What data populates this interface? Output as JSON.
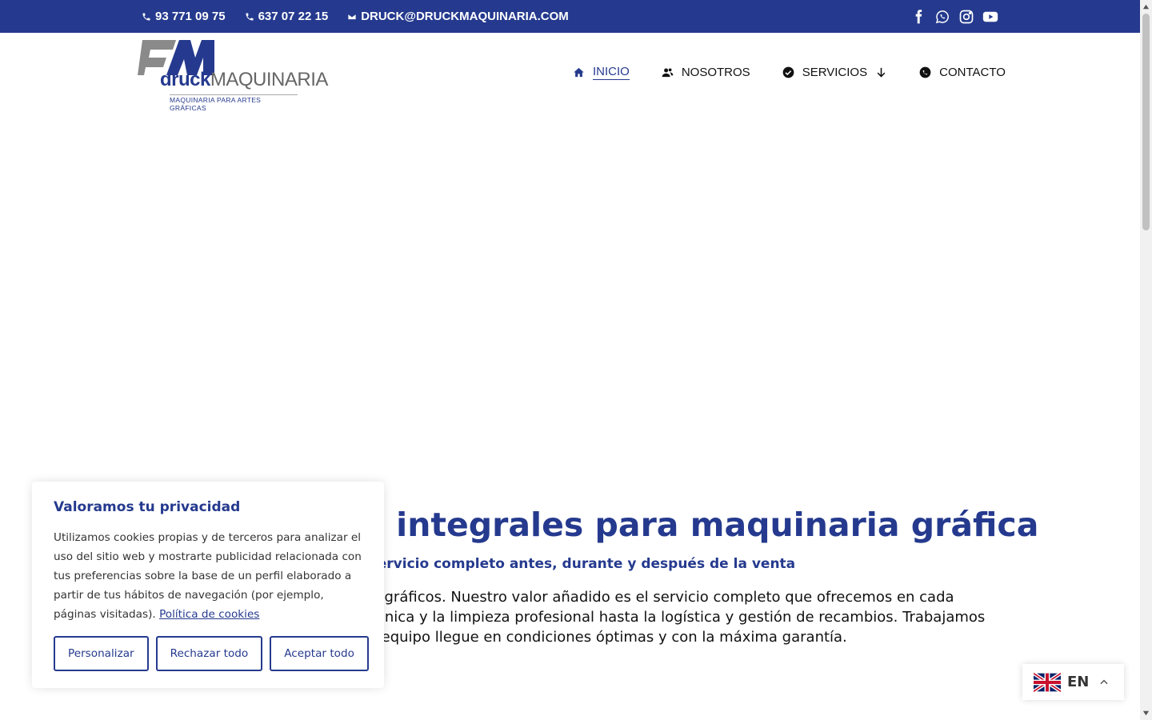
{
  "topbar": {
    "phone1": "93 771 09 75",
    "phone2": "637 07 22 15",
    "email": "DRUCK@DRUCKMAQUINARIA.COM",
    "social_icons": [
      "facebook-icon",
      "whatsapp-icon",
      "instagram-icon",
      "youtube-icon"
    ]
  },
  "logo": {
    "word1": "druck",
    "word2": "MAQUINARIA",
    "tagline": "MAQUINARIA PARA ARTES GRÁFICAS"
  },
  "nav": {
    "items": [
      {
        "label": "INICIO",
        "icon": "home-icon",
        "active": true
      },
      {
        "label": "NOSOTROS",
        "icon": "users-icon",
        "active": false
      },
      {
        "label": "SERVICIOS",
        "icon": "check-circle-icon",
        "active": false
      },
      {
        "label": "CONTACTO",
        "icon": "phone-circle-icon",
        "active": false
      }
    ]
  },
  "hero": {
    "title": "Soluciones integrales para maquinaria gráfica",
    "subtitle": "Un servicio completo antes, durante y después de la venta",
    "body": "No solo vendemos equipos gráficos. Nuestro valor añadido es el servicio completo que ofrecemos en cada operación: desde la revisión técnica y la limpieza profesional hasta la logística y gestión de recambios. Trabajamos para que tu equipo llegue en condiciones óptimas y con la máxima garantía."
  },
  "cookie": {
    "title": "Valoramos tu privacidad",
    "text": "Utilizamos cookies propias y de terceros para analizar el uso del sitio web y mostrarte publicidad relacionada con tus preferencias sobre la base de un perfil elaborado a partir de tus hábitos de navegación (por ejemplo, páginas visitadas).",
    "link": "Política de cookies",
    "buttons": {
      "customize": "Personalizar",
      "reject": "Rechazar todo",
      "accept": "Aceptar todo"
    }
  },
  "language": {
    "code": "EN"
  },
  "colors": {
    "brand": "#253a8e",
    "text": "#111111",
    "background": "#ffffff"
  }
}
